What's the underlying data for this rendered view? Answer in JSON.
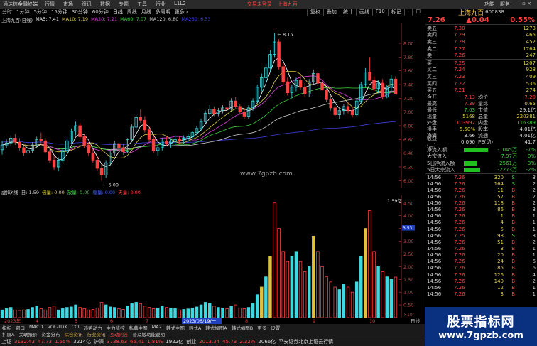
{
  "topbar": {
    "logo": "通达信金融终端",
    "menu": [
      "行情",
      "市场",
      "资讯",
      "数据",
      "专题",
      "工具",
      "行业",
      "L1L2"
    ],
    "ticker": "交易未登录",
    "ticker2": "上海九百",
    "right": [
      "功能",
      "服务",
      "— ▫ ×"
    ]
  },
  "period_tabs": [
    "分时",
    "1分钟",
    "5分钟",
    "15分钟",
    "30分钟",
    "60分钟",
    "日线",
    "周线",
    "月线",
    "多周期",
    "更多 ›"
  ],
  "active_period": "日线",
  "chart_tools": [
    "复权",
    "叠加",
    "统计",
    "画线",
    "F10",
    "标记",
    "-",
    "□"
  ],
  "ma_legend": {
    "title": "上海九百(日线)",
    "items": [
      {
        "label": "MA5: 7.41",
        "color": "#ffffff"
      },
      {
        "label": "MA10: 7.19",
        "color": "#e0d040"
      },
      {
        "label": "MA20: 7.21",
        "color": "#e040e0"
      },
      {
        "label": "MA60: 7.07",
        "color": "#40d040"
      },
      {
        "label": "MA120: 6.80",
        "color": "#d0d0d0"
      },
      {
        "label": "MA250: 6.53",
        "color": "#4040e0"
      }
    ]
  },
  "price_axis": [
    "8.00",
    "7.80",
    "7.60",
    "7.40",
    "7.20",
    "7.00",
    "6.80",
    "6.60",
    "6.40",
    "6.20",
    "6.00"
  ],
  "price_high": "8.15",
  "price_low": "6.00",
  "watermark_text": "www.7gpzb.com",
  "vol_header": {
    "items": [
      {
        "label": "虚拟K线",
        "color": "#ccc"
      },
      {
        "label": "日: 1.59",
        "color": "#ccc"
      },
      {
        "label": "倍量: 0.00",
        "color": "#e0d040"
      },
      {
        "label": "放量: 0.00",
        "color": "#40d040"
      },
      {
        "label": "缩量: 0.00",
        "color": "#4060ff"
      },
      {
        "label": "天量: 0.00",
        "color": "#ff4040"
      }
    ]
  },
  "vol_axis": [
    "4.50",
    "4.00",
    "3.50",
    "3.00",
    "2.50",
    "2.00",
    "1.50",
    "1.00",
    "0.50"
  ],
  "vol_axis_unit": "×10⁷",
  "vol_max_label": "1.59亿",
  "vol_marker": "3.53",
  "xaxis_labels": [
    "2023年",
    "4",
    "5",
    "6",
    "7",
    "2023/06/19/一",
    "8",
    "9",
    "10"
  ],
  "xaxis_right": "日线",
  "tabs1": [
    "指标",
    "窗口",
    "MACD",
    "VOL-TDX",
    "CCI",
    "趋势动力",
    "主力监控",
    "私募主图",
    "MA2",
    "韩式主图",
    "韩式A",
    "韩式幅图A",
    "韩式幅图B",
    "更多",
    "设置"
  ],
  "tabs2": [
    {
      "label": "扩展A",
      "cls": ""
    },
    {
      "label": "关联报价",
      "cls": ""
    },
    {
      "label": "资金分布",
      "cls": ""
    },
    {
      "label": "综合资讯",
      "cls": "yl"
    },
    {
      "label": "行业资讯",
      "cls": "yl"
    },
    {
      "label": "互动问答",
      "cls": "hl"
    },
    {
      "label": "普及版功能说明",
      "cls": ""
    }
  ],
  "statusbar": {
    "items": [
      {
        "text": "上证",
        "color": "wht"
      },
      {
        "text": "3132.43",
        "color": "red"
      },
      {
        "text": "47.73",
        "color": "red"
      },
      {
        "text": "1.55%",
        "color": "red"
      },
      {
        "text": "3214亿",
        "color": "wht"
      },
      {
        "text": "沪深",
        "color": "wht"
      },
      {
        "text": "3738.63",
        "color": "red"
      },
      {
        "text": "65.41",
        "color": "red"
      },
      {
        "text": "1.81%",
        "color": "red"
      },
      {
        "text": "1922亿",
        "color": "wht"
      },
      {
        "text": "创业",
        "color": "wht"
      },
      {
        "text": "2013.34",
        "color": "red"
      },
      {
        "text": "45.73",
        "color": "red"
      },
      {
        "text": "2.32%",
        "color": "red"
      },
      {
        "text": "2066亿",
        "color": "wht"
      },
      {
        "text": "平安证券北京上证云行情",
        "color": "wht"
      }
    ]
  },
  "right_panel": {
    "name": "上海九百",
    "code": "600838",
    "price": "7.26",
    "change": "▲0.04",
    "change_pct": "0.55%",
    "sells": [
      {
        "label": "卖五",
        "price": "7.30",
        "vol": "1273"
      },
      {
        "label": "卖四",
        "price": "7.29",
        "vol": "465"
      },
      {
        "label": "卖三",
        "price": "7.28",
        "vol": "452"
      },
      {
        "label": "卖二",
        "price": "7.27",
        "vol": "1764"
      },
      {
        "label": "卖一",
        "price": "7.26",
        "vol": "247"
      }
    ],
    "buys": [
      {
        "label": "买一",
        "price": "7.25",
        "vol": "1207"
      },
      {
        "label": "买二",
        "price": "7.24",
        "vol": "928"
      },
      {
        "label": "买三",
        "price": "7.23",
        "vol": "409"
      },
      {
        "label": "买四",
        "price": "7.22",
        "vol": "536"
      },
      {
        "label": "买五",
        "price": "7.21",
        "vol": "274"
      }
    ],
    "stats": [
      {
        "a": "今开",
        "b": "7.13",
        "bc": "red",
        "c": "均价",
        "d": "7.20",
        "dc": "red"
      },
      {
        "a": "最高",
        "b": "7.39",
        "bc": "red",
        "c": "量比",
        "d": "0.65",
        "dc": "yel"
      },
      {
        "a": "最低",
        "b": "7.03",
        "bc": "grn",
        "c": "市值",
        "d": "29.1亿",
        "dc": "wht"
      },
      {
        "a": "现量",
        "b": "5168",
        "bc": "yel",
        "c": "总量",
        "d": "220381",
        "dc": "yel"
      },
      {
        "a": "外盘",
        "b": "103992",
        "bc": "red",
        "c": "内盘",
        "d": "116389",
        "dc": "grn"
      },
      {
        "a": "换手",
        "b": "5.50%",
        "bc": "yel",
        "c": "股本",
        "d": "4.01亿",
        "dc": "wht"
      },
      {
        "a": "净资",
        "b": "3.66",
        "bc": "wht",
        "c": "流通",
        "d": "4.01亿",
        "dc": "wht"
      },
      {
        "a": "收益(二)",
        "b": "0.090",
        "bc": "wht",
        "c": "PE(动)",
        "d": "41.7",
        "dc": "wht"
      }
    ],
    "flows": [
      {
        "name": "净流入额",
        "bar_pct": 0.9,
        "value": "-1045万",
        "pct": "-7%"
      },
      {
        "name": "大宗流入",
        "bar_pct": 0.0,
        "value": "7.97万",
        "pct": "0%"
      },
      {
        "name": "5日净流入额",
        "bar_pct": 0.5,
        "value": "-2561万",
        "pct": "-3%"
      },
      {
        "name": "5日大宗流入",
        "bar_pct": 0.6,
        "value": "-2273万",
        "pct": "-2%"
      }
    ],
    "ticks": [
      {
        "t": "14:56",
        "p": "7.26",
        "v": "320",
        "s": "S",
        "sc": "grn",
        "q": "3"
      },
      {
        "t": "14:56",
        "p": "7.26",
        "v": "164",
        "s": "S",
        "sc": "grn",
        "q": "2"
      },
      {
        "t": "14:56",
        "p": "7.26",
        "v": "11",
        "s": "B",
        "sc": "red",
        "q": "2"
      },
      {
        "t": "14:56",
        "p": "7.26",
        "v": "57",
        "s": "B",
        "sc": "red",
        "q": "2"
      },
      {
        "t": "14:56",
        "p": "7.26",
        "v": "118",
        "s": "B",
        "sc": "red",
        "q": "2"
      },
      {
        "t": "14:56",
        "p": "7.26",
        "v": "86",
        "s": "B",
        "sc": "red",
        "q": "3"
      },
      {
        "t": "14:56",
        "p": "7.26",
        "v": "1",
        "s": "B",
        "sc": "red",
        "q": "1"
      },
      {
        "t": "14:56",
        "p": "7.26",
        "v": "4",
        "s": "B",
        "sc": "red",
        "q": "1"
      },
      {
        "t": "14:56",
        "p": "7.26",
        "v": "5",
        "s": "B",
        "sc": "red",
        "q": "1"
      },
      {
        "t": "14:56",
        "p": "7.25",
        "v": "98",
        "s": "S",
        "sc": "grn",
        "q": "3"
      },
      {
        "t": "14:56",
        "p": "7.26",
        "v": "51",
        "s": "B",
        "sc": "red",
        "q": "2"
      },
      {
        "t": "14:56",
        "p": "7.26",
        "v": "3",
        "s": "B",
        "sc": "red",
        "q": "1"
      },
      {
        "t": "14:56",
        "p": "7.26",
        "v": "20",
        "s": "B",
        "sc": "red",
        "q": "1"
      },
      {
        "t": "14:56",
        "p": "7.26",
        "v": "24",
        "s": "B",
        "sc": "red",
        "q": "6"
      },
      {
        "t": "14:56",
        "p": "7.26",
        "v": "85",
        "s": "B",
        "sc": "red",
        "q": "6"
      },
      {
        "t": "14:56",
        "p": "7.26",
        "v": "126",
        "s": "B",
        "sc": "red",
        "q": "4"
      },
      {
        "t": "14:56",
        "p": "7.26",
        "v": "140",
        "s": "B",
        "sc": "red",
        "q": "2"
      },
      {
        "t": "14:56",
        "p": "7.26",
        "v": "12",
        "s": "B",
        "sc": "red",
        "q": "1"
      },
      {
        "t": "14:56",
        "p": "7.26",
        "v": "3",
        "s": "B",
        "sc": "red",
        "q": "1"
      }
    ]
  },
  "corner_watermark": {
    "line1": "股票指标网",
    "line2": "www.7gpzb.com"
  },
  "chart_data": {
    "type": "candlestick",
    "series_colors": {
      "up": "#40d8e0",
      "down": "#ff4040"
    },
    "note": "price in CNY; approximate daily closes read from chart",
    "candles": [
      [
        6.45,
        6.58,
        6.38,
        6.52
      ],
      [
        6.52,
        6.6,
        6.48,
        6.55
      ],
      [
        6.55,
        6.66,
        6.5,
        6.62
      ],
      [
        6.62,
        6.68,
        6.52,
        6.56
      ],
      [
        6.56,
        6.62,
        6.44,
        6.48
      ],
      [
        6.48,
        6.52,
        6.36,
        6.4
      ],
      [
        6.4,
        6.48,
        6.32,
        6.44
      ],
      [
        6.44,
        6.56,
        6.4,
        6.52
      ],
      [
        6.52,
        6.64,
        6.48,
        6.6
      ],
      [
        6.6,
        6.7,
        6.54,
        6.58
      ],
      [
        6.58,
        6.62,
        6.4,
        6.42
      ],
      [
        6.42,
        6.46,
        6.26,
        6.3
      ],
      [
        6.3,
        6.36,
        6.16,
        6.2
      ],
      [
        6.2,
        6.34,
        6.14,
        6.3
      ],
      [
        6.3,
        6.48,
        6.26,
        6.44
      ],
      [
        6.44,
        6.62,
        6.4,
        6.58
      ],
      [
        6.58,
        6.76,
        6.54,
        6.72
      ],
      [
        6.72,
        6.86,
        6.66,
        6.8
      ],
      [
        6.8,
        6.84,
        6.6,
        6.64
      ],
      [
        6.64,
        6.68,
        6.48,
        6.52
      ],
      [
        6.52,
        6.56,
        6.36,
        6.4
      ],
      [
        6.4,
        6.46,
        6.26,
        6.3
      ],
      [
        6.3,
        6.36,
        6.14,
        6.18
      ],
      [
        6.18,
        6.24,
        6.0,
        6.08
      ],
      [
        6.08,
        6.3,
        6.04,
        6.26
      ],
      [
        6.26,
        6.44,
        6.22,
        6.4
      ],
      [
        6.4,
        6.58,
        6.36,
        6.54
      ],
      [
        6.54,
        6.62,
        6.44,
        6.48
      ],
      [
        6.48,
        6.54,
        6.38,
        6.42
      ],
      [
        6.42,
        6.62,
        6.4,
        6.6
      ],
      [
        6.6,
        6.82,
        6.56,
        6.78
      ],
      [
        6.78,
        6.96,
        6.74,
        6.92
      ],
      [
        6.92,
        7.04,
        6.84,
        6.88
      ],
      [
        6.88,
        6.94,
        6.7,
        6.74
      ],
      [
        6.74,
        6.8,
        6.56,
        6.6
      ],
      [
        6.6,
        6.66,
        6.4,
        6.44
      ],
      [
        6.44,
        6.52,
        6.36,
        6.48
      ],
      [
        6.48,
        6.62,
        6.44,
        6.58
      ],
      [
        6.58,
        6.64,
        6.5,
        6.54
      ],
      [
        6.54,
        6.62,
        6.48,
        6.58
      ],
      [
        6.58,
        6.66,
        6.52,
        6.6
      ],
      [
        6.6,
        6.64,
        6.54,
        6.58
      ],
      [
        6.58,
        6.66,
        6.54,
        6.62
      ],
      [
        6.62,
        6.68,
        6.56,
        6.64
      ],
      [
        6.64,
        6.72,
        6.6,
        6.7
      ],
      [
        6.7,
        6.8,
        6.66,
        6.76
      ],
      [
        6.76,
        6.9,
        6.72,
        6.86
      ],
      [
        6.86,
        7.02,
        6.82,
        6.98
      ],
      [
        6.98,
        7.1,
        6.92,
        7.04
      ],
      [
        7.04,
        7.08,
        6.94,
        6.98
      ],
      [
        6.98,
        7.06,
        6.94,
        7.02
      ],
      [
        7.02,
        7.1,
        6.98,
        7.06
      ],
      [
        7.06,
        7.12,
        7.0,
        7.04
      ],
      [
        7.04,
        7.2,
        7.0,
        7.16
      ],
      [
        7.16,
        7.22,
        7.04,
        7.08
      ],
      [
        7.08,
        7.12,
        6.96,
        7.0
      ],
      [
        7.0,
        7.06,
        6.9,
        6.94
      ],
      [
        6.94,
        7.1,
        6.9,
        7.06
      ],
      [
        7.06,
        7.2,
        7.02,
        7.16
      ],
      [
        7.16,
        7.4,
        7.12,
        7.36
      ],
      [
        7.36,
        7.56,
        7.3,
        7.5
      ],
      [
        7.5,
        7.7,
        7.44,
        7.64
      ],
      [
        7.64,
        7.9,
        7.58,
        7.84
      ],
      [
        7.84,
        8.15,
        7.8,
        8.02
      ],
      [
        8.02,
        8.06,
        7.62,
        7.66
      ],
      [
        7.66,
        7.72,
        7.4,
        7.44
      ],
      [
        7.44,
        7.5,
        7.24,
        7.28
      ],
      [
        7.28,
        7.4,
        7.2,
        7.36
      ],
      [
        7.36,
        7.5,
        7.3,
        7.46
      ],
      [
        7.46,
        7.54,
        7.32,
        7.36
      ],
      [
        7.36,
        7.42,
        7.22,
        7.26
      ],
      [
        7.26,
        7.48,
        7.22,
        7.44
      ],
      [
        7.44,
        7.62,
        7.4,
        7.56
      ],
      [
        7.56,
        7.64,
        7.38,
        7.42
      ],
      [
        7.42,
        7.48,
        7.28,
        7.32
      ],
      [
        7.32,
        7.36,
        7.14,
        7.18
      ],
      [
        7.18,
        7.24,
        7.02,
        7.06
      ],
      [
        7.06,
        7.1,
        6.92,
        6.96
      ],
      [
        6.96,
        7.06,
        6.9,
        7.02
      ],
      [
        7.02,
        7.12,
        6.96,
        7.08
      ],
      [
        7.08,
        7.14,
        6.98,
        7.02
      ],
      [
        7.02,
        7.08,
        6.92,
        6.96
      ],
      [
        6.96,
        7.2,
        6.94,
        7.16
      ],
      [
        7.16,
        7.44,
        7.12,
        7.4
      ],
      [
        7.4,
        7.64,
        7.36,
        7.58
      ],
      [
        7.58,
        7.8,
        7.52,
        7.46
      ],
      [
        7.46,
        7.52,
        7.3,
        7.34
      ],
      [
        7.34,
        7.46,
        7.28,
        7.42
      ],
      [
        7.42,
        7.48,
        7.18,
        7.22
      ],
      [
        7.22,
        7.4,
        7.2,
        7.36
      ],
      [
        7.36,
        7.54,
        7.3,
        7.48
      ],
      [
        7.48,
        7.52,
        7.28,
        7.26
      ]
    ],
    "volumes": [
      0.3,
      0.35,
      0.4,
      0.3,
      0.28,
      0.3,
      0.32,
      0.4,
      0.45,
      0.35,
      0.3,
      0.4,
      0.45,
      0.3,
      0.35,
      0.4,
      0.42,
      0.5,
      0.4,
      0.35,
      0.3,
      0.32,
      0.38,
      0.6,
      0.5,
      0.42,
      0.4,
      0.35,
      0.32,
      0.45,
      0.55,
      0.6,
      0.55,
      0.45,
      0.4,
      0.35,
      0.38,
      0.45,
      0.4,
      0.38,
      0.35,
      0.3,
      0.32,
      0.34,
      0.38,
      0.42,
      0.5,
      0.6,
      0.55,
      0.45,
      0.4,
      0.38,
      0.35,
      0.45,
      0.5,
      0.38,
      0.35,
      0.4,
      0.55,
      0.9,
      1.2,
      1.6,
      2.4,
      4.5,
      3.5,
      2.6,
      2.2,
      2.4,
      2.6,
      2.2,
      1.8,
      2.0,
      3.2,
      2.6,
      2.0,
      1.6,
      1.4,
      1.2,
      1.1,
      1.3,
      1.2,
      1.0,
      1.4,
      2.4,
      3.5,
      4.2,
      2.6,
      2.0,
      1.8,
      1.6,
      1.5,
      1.59
    ],
    "vol_colors": [
      "c",
      "c",
      "c",
      "r",
      "r",
      "r",
      "c",
      "c",
      "c",
      "r",
      "r",
      "r",
      "r",
      "c",
      "c",
      "c",
      "c",
      "c",
      "r",
      "r",
      "r",
      "r",
      "r",
      "r",
      "c",
      "c",
      "c",
      "r",
      "r",
      "c",
      "c",
      "c",
      "r",
      "r",
      "r",
      "r",
      "c",
      "c",
      "r",
      "c",
      "c",
      "r",
      "c",
      "c",
      "c",
      "c",
      "c",
      "c",
      "c",
      "r",
      "c",
      "c",
      "r",
      "c",
      "r",
      "r",
      "r",
      "c",
      "c",
      "c",
      "y",
      "c",
      "y",
      "r",
      "r",
      "r",
      "r",
      "c",
      "c",
      "r",
      "r",
      "c",
      "y",
      "r",
      "r",
      "r",
      "r",
      "r",
      "c",
      "c",
      "r",
      "r",
      "c",
      "c",
      "y",
      "r",
      "r",
      "c",
      "r",
      "c",
      "c",
      "r"
    ],
    "ma_lines": {
      "ma5": "#ffffff",
      "ma10": "#e0d040",
      "ma20": "#e040e0",
      "ma60": "#40d040",
      "ma120": "#d0d0d0",
      "ma250": "#4040e0"
    },
    "ylim": [
      5.9,
      8.3
    ],
    "vol_ylim": [
      0,
      4.8
    ]
  }
}
